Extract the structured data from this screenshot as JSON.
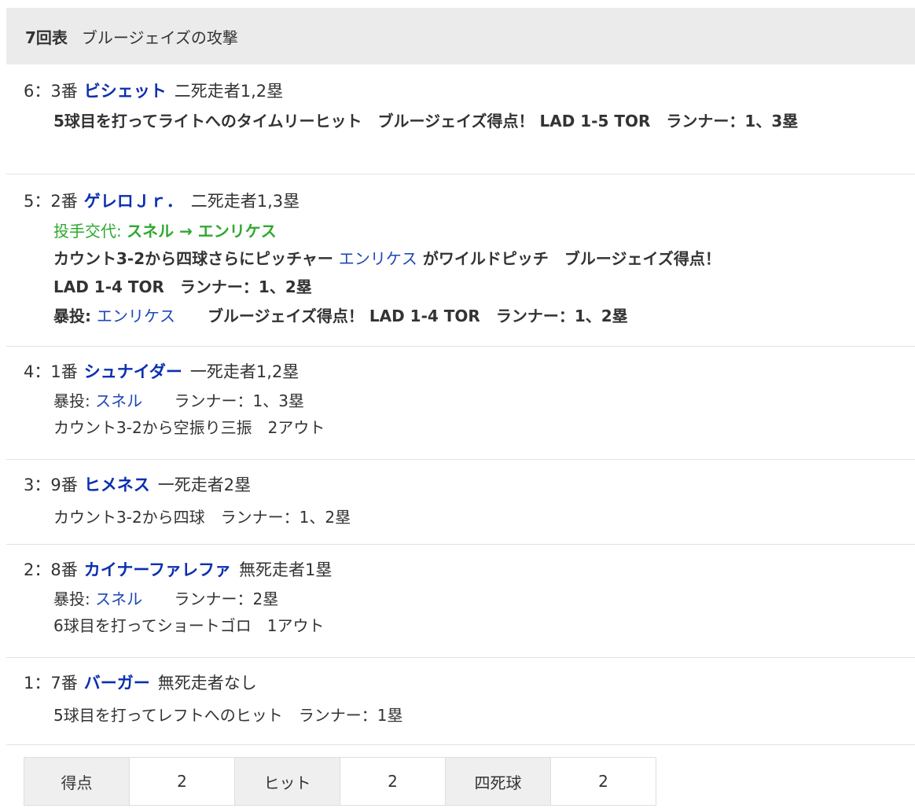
{
  "inning": {
    "number": "7回表",
    "title": "ブルージェイズの攻撃"
  },
  "plays": [
    {
      "order": "6：3番",
      "batter": "ビシェット",
      "situation": "二死走者1,2塁",
      "result": "5球目を打ってライトへのタイムリーヒット　ブルージェイズ得点！ LAD 1-5 TOR　ランナー：1、3塁"
    },
    {
      "order": "5：2番",
      "batter": "ゲレロＪｒ．",
      "situation": "二死走者1,3塁",
      "pitch_change_label": "投手交代:",
      "pitch_change": "スネル → エンリケス",
      "result_pre": "カウント3-2から四球さらにピッチャー",
      "result_link": "エンリケス",
      "result_post": "がワイルドピッチ　ブルージェイズ得点！",
      "result_line2": "LAD 1-4 TOR　ランナー：1、2塁",
      "wild_label": "暴投:",
      "wild_player": "エンリケス",
      "wild_text": "ブルージェイズ得点！ LAD 1-4 TOR　ランナー：1、2塁"
    },
    {
      "order": "4：1番",
      "batter": "シュナイダー",
      "situation": "一死走者1,2塁",
      "wild_label": "暴投:",
      "wild_player": "スネル",
      "wild_text": "ランナー：1、3塁",
      "result": "カウント3-2から空振り三振　2アウト"
    },
    {
      "order": "3：9番",
      "batter": "ヒメネス",
      "situation": "一死走者2塁",
      "result": "カウント3-2から四球　ランナー：1、2塁"
    },
    {
      "order": "2：8番",
      "batter": "カイナーファレファ",
      "situation": "無死走者1塁",
      "wild_label": "暴投:",
      "wild_player": "スネル",
      "wild_text": "ランナー：2塁",
      "result": "6球目を打ってショートゴロ　1アウト"
    },
    {
      "order": "1：7番",
      "batter": "バーガー",
      "situation": "無死走者なし",
      "result": "5球目を打ってレフトへのヒット　ランナー：1塁"
    }
  ],
  "summary": {
    "runs_label": "得点",
    "runs": "2",
    "hits_label": "ヒット",
    "hits": "2",
    "walks_label": "四死球",
    "walks": "2"
  }
}
